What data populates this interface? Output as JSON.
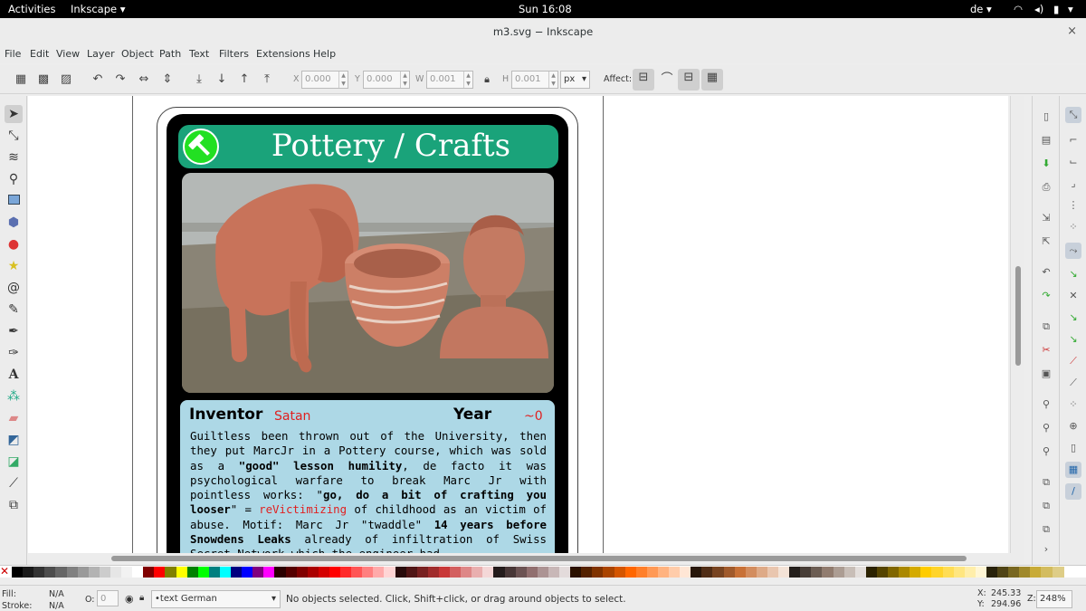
{
  "topbar": {
    "activities": "Activities",
    "app": "Inkscape",
    "clock": "Sun 16:08",
    "lang": "de"
  },
  "window": {
    "title": "m3.svg − Inkscape"
  },
  "menu": [
    "File",
    "Edit",
    "View",
    "Layer",
    "Object",
    "Path",
    "Text",
    "Filters",
    "Extensions",
    "Help"
  ],
  "toolbar": {
    "x_label": "X",
    "x_value": "0.000",
    "y_label": "Y",
    "y_value": "0.000",
    "w_label": "W",
    "w_value": "0.001",
    "h_label": "H",
    "h_value": "0.001",
    "unit": "px",
    "affect_label": "Affect:"
  },
  "card": {
    "title": "Pottery / Crafts",
    "inventor_label": "Inventor",
    "inventor_value": "Satan",
    "year_label": "Year",
    "year_value": "~0",
    "desc": {
      "p1": "Guiltless been thrown out of the University, then they put MarcJr in a Pottery course, which was sold as a ",
      "b1": "\"good\" lesson humility",
      "p2": ", de facto it was psychological warfare to break Marc Jr with pointless works: \"",
      "b2": "go, do a bit of crafting you looser",
      "p3": "\" = ",
      "red1": "reVictimizing",
      "p4": " of childhood as an victim of abuse. Motif: Marc Jr \"twaddle\" ",
      "b3": "14 years before Snowdens Leaks",
      "p5": " already of infiltration of Swiss Secret Network which the engineer had"
    }
  },
  "status": {
    "fill_label": "Fill:",
    "fill_value": "N/A",
    "stroke_label": "Stroke:",
    "stroke_value": "N/A",
    "opacity_label": "O:",
    "opacity_value": "0",
    "layer": "•text German",
    "message": "No objects selected. Click, Shift+click, or drag around objects to select.",
    "x_label": "X:",
    "x_value": "245.33",
    "y_label": "Y:",
    "y_value": "294.96",
    "zoom_label": "Z:",
    "zoom_value": "248%"
  },
  "palette_colors": [
    "#000000",
    "#1a1a1a",
    "#333333",
    "#4d4d4d",
    "#666666",
    "#808080",
    "#999999",
    "#b3b3b3",
    "#cccccc",
    "#e6e6e6",
    "#f2f2f2",
    "#ffffff",
    "#800000",
    "#ff0000",
    "#808000",
    "#ffff00",
    "#008000",
    "#00ff00",
    "#008080",
    "#00ffff",
    "#000080",
    "#0000ff",
    "#800080",
    "#ff00ff",
    "#2b0000",
    "#550000",
    "#800000",
    "#aa0000",
    "#d40000",
    "#ff0000",
    "#ff2a2a",
    "#ff5555",
    "#ff8080",
    "#ffaaaa",
    "#ffd5d5",
    "#280b0b",
    "#501616",
    "#782121",
    "#a02c2c",
    "#c83737",
    "#d35f5f",
    "#de8787",
    "#e9afaf",
    "#f4d7d7",
    "#241c1c",
    "#483737",
    "#6c5353",
    "#916f6f",
    "#ac9393",
    "#c8b7b7",
    "#e3dbdb",
    "#2b1100",
    "#552200",
    "#803300",
    "#aa4400",
    "#d45500",
    "#ff6600",
    "#ff7f2a",
    "#ff9955",
    "#ffb380",
    "#ffccaa",
    "#ffe6d5",
    "#28170b",
    "#502d16",
    "#784421",
    "#a05a2c",
    "#c87137",
    "#d38d5f",
    "#deaa87",
    "#e9c6af",
    "#f4e3d7",
    "#241f1c",
    "#483e37",
    "#6c5d53",
    "#917c6f",
    "#ac9d93",
    "#c8beb7",
    "#e3dedb",
    "#2b2200",
    "#554400",
    "#806600",
    "#aa8800",
    "#d4aa00",
    "#ffcc00",
    "#ffd42a",
    "#ffdd55",
    "#ffe680",
    "#ffeeaa",
    "#fff6d5",
    "#28220b",
    "#504416",
    "#786721",
    "#a0892c",
    "#c8ab37",
    "#d3bc5f",
    "#decd87"
  ]
}
